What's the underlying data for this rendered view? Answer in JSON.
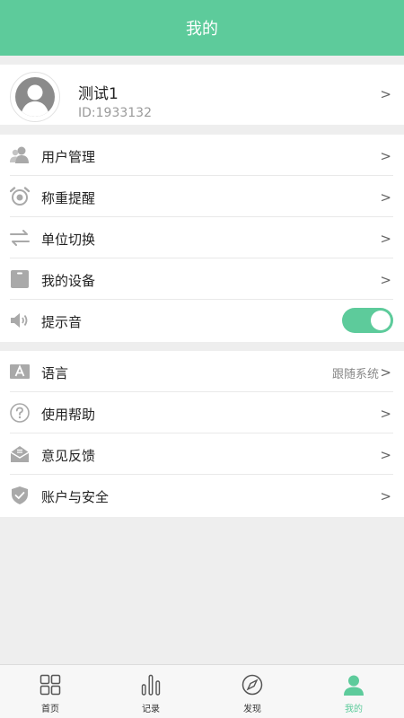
{
  "header": {
    "title": "我的"
  },
  "profile": {
    "name": "测试1",
    "id": "ID:1933132",
    "chevron": ">"
  },
  "group1": [
    {
      "name": "user-management",
      "label": "用户管理",
      "icon": "users-icon",
      "chevron": ">"
    },
    {
      "name": "weigh-reminder",
      "label": "称重提醒",
      "icon": "alarm-clock-icon",
      "chevron": ">"
    },
    {
      "name": "unit-switch",
      "label": "单位切换",
      "icon": "swap-arrows-icon",
      "chevron": ">"
    },
    {
      "name": "my-devices",
      "label": "我的设备",
      "icon": "device-icon",
      "chevron": ">"
    },
    {
      "name": "prompt-sound",
      "label": "提示音",
      "icon": "speaker-icon",
      "toggle_on": true
    }
  ],
  "group2": [
    {
      "name": "language",
      "label": "语言",
      "icon": "language-a-icon",
      "value": "跟随系统",
      "chevron": ">"
    },
    {
      "name": "help",
      "label": "使用帮助",
      "icon": "question-icon",
      "chevron": ">"
    },
    {
      "name": "feedback",
      "label": "意见反馈",
      "icon": "envelope-icon",
      "chevron": ">"
    },
    {
      "name": "account-security",
      "label": "账户与安全",
      "icon": "shield-check-icon",
      "chevron": ">"
    }
  ],
  "tabbar": [
    {
      "label": "首页",
      "icon": "grid-icon",
      "active": false
    },
    {
      "label": "记录",
      "icon": "bar-chart-icon",
      "active": false
    },
    {
      "label": "发现",
      "icon": "compass-icon",
      "active": false
    },
    {
      "label": "我的",
      "icon": "person-icon",
      "active": true
    }
  ],
  "colors": {
    "accent": "#5dcb9b",
    "background": "#eeeeee",
    "icon_gray": "#a9a9a9"
  }
}
